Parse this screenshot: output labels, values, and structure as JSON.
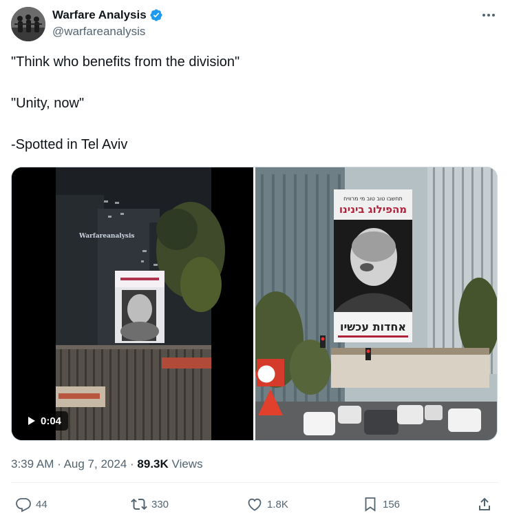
{
  "author": {
    "display_name": "Warfare Analysis",
    "handle": "@warfareanalysis",
    "verified": true
  },
  "tweet": {
    "lines": [
      "\"Think who benefits from the division\"",
      "\"Unity, now\"",
      "-Spotted in Tel Aviv"
    ]
  },
  "media": {
    "video": {
      "duration": "0:04",
      "watermark": "Warfareanalysis",
      "icon": "play-icon"
    },
    "photo": {
      "billboard_top_line1": "תחשבו טוב טוב מי מרוויח",
      "billboard_top_line2": "מהפילוג בינינו",
      "billboard_bottom": "אחדות עכשיו"
    }
  },
  "meta": {
    "time": "3:39 AM",
    "separator": "·",
    "date": "Aug 7, 2024",
    "views_count": "89.3K",
    "views_label": "Views"
  },
  "actions": {
    "replies": "44",
    "retweets": "330",
    "likes": "1.8K",
    "bookmarks": "156"
  },
  "colors": {
    "text_primary": "#0f1419",
    "text_secondary": "#536471",
    "verified": "#1d9bf0",
    "divider": "#eff3f4"
  }
}
